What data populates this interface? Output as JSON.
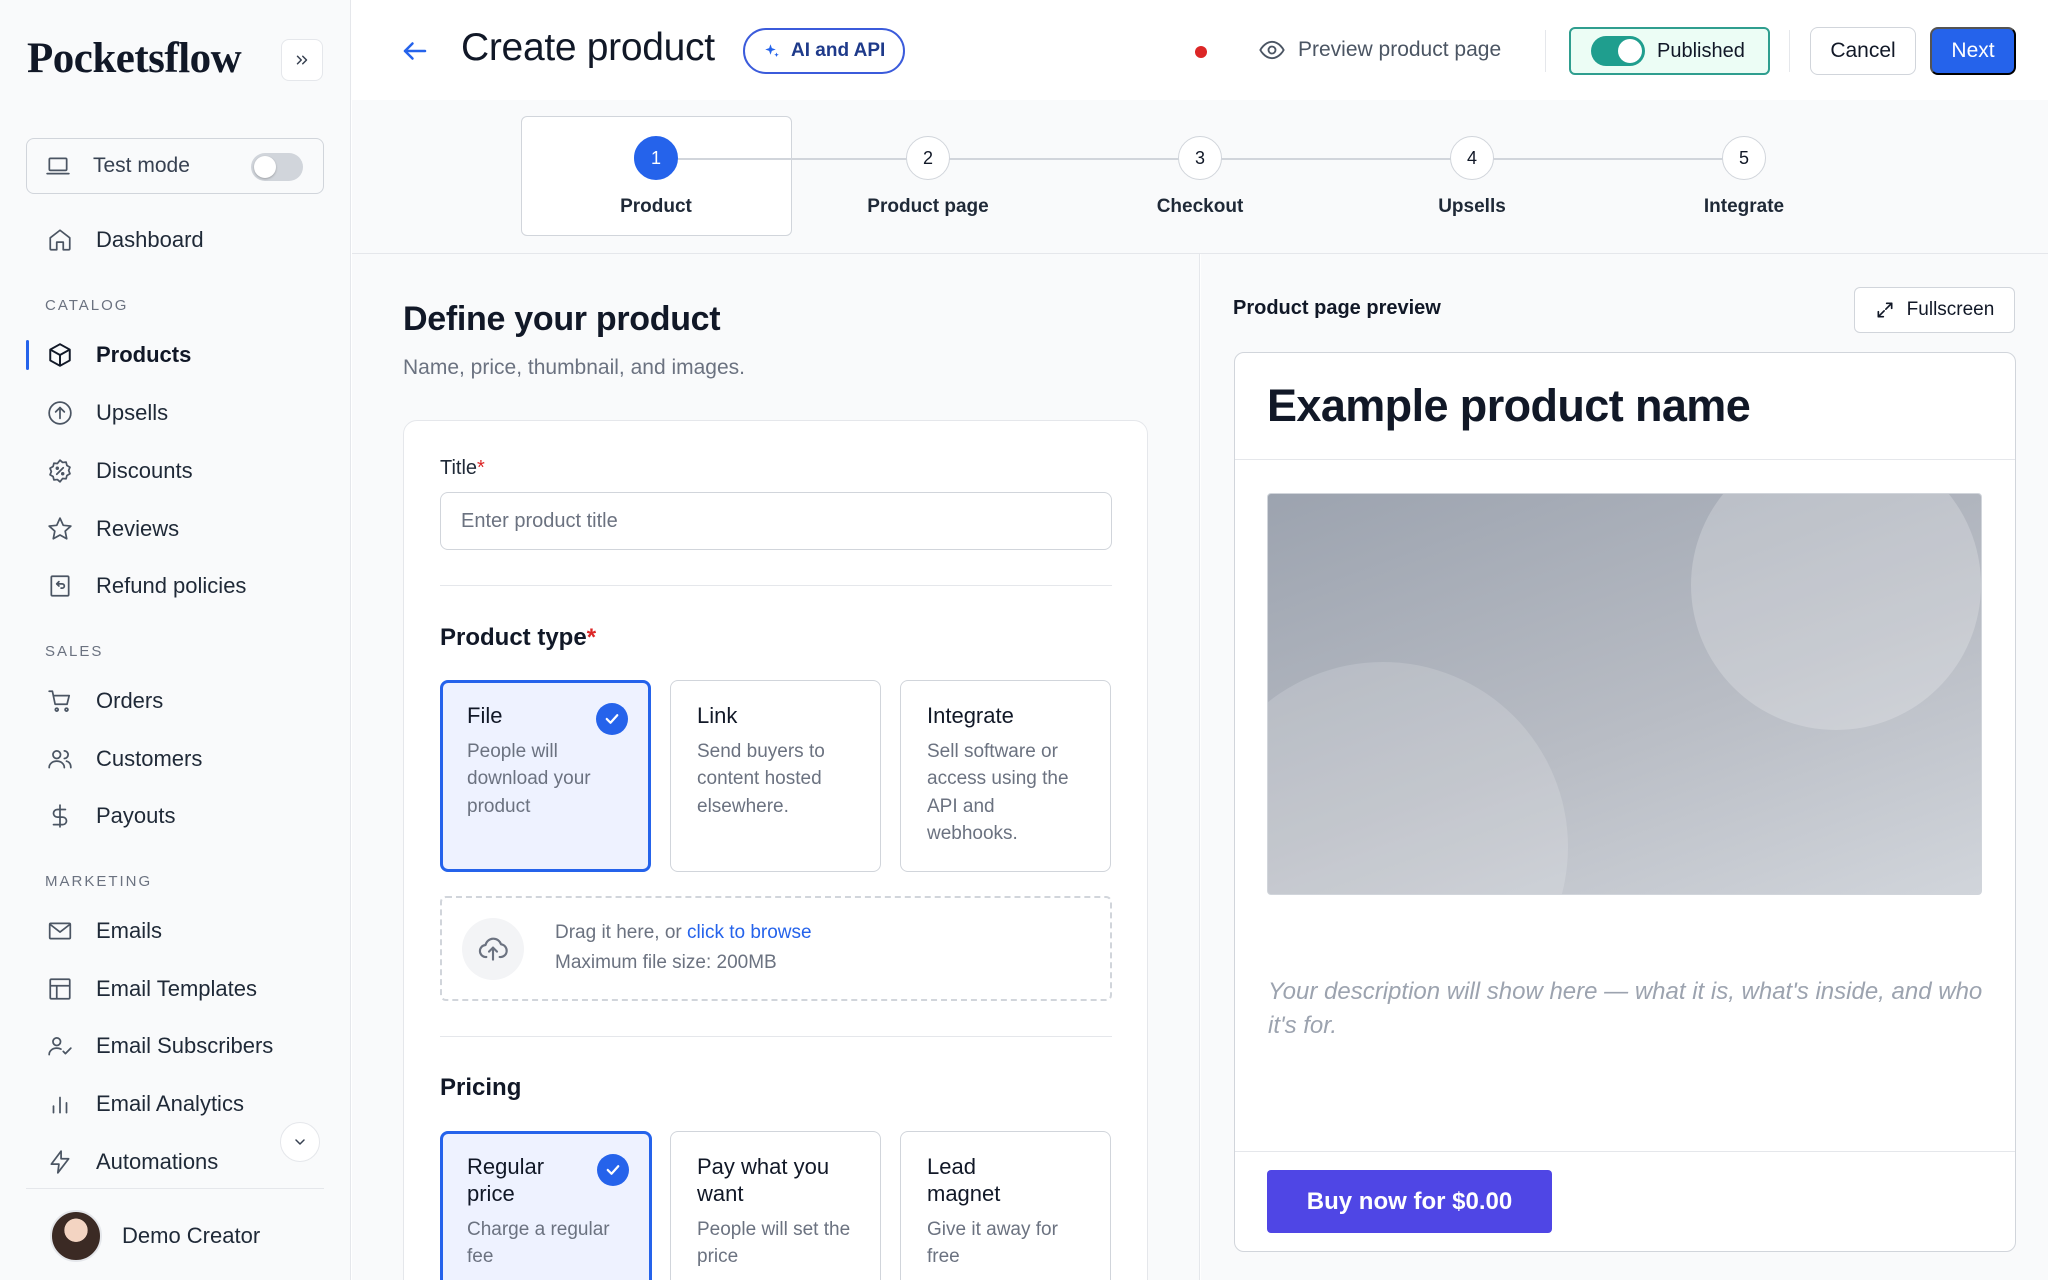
{
  "app": {
    "brand": "Pocketsflow"
  },
  "sidebar": {
    "test_mode_label": "Test mode",
    "dashboard": "Dashboard",
    "sections": {
      "catalog": "CATALOG",
      "sales": "SALES",
      "marketing": "MARKETING"
    },
    "catalog": [
      "Products",
      "Upsells",
      "Discounts",
      "Reviews",
      "Refund policies"
    ],
    "sales": [
      "Orders",
      "Customers",
      "Payouts"
    ],
    "marketing": [
      "Emails",
      "Email Templates",
      "Email Subscribers",
      "Email Analytics",
      "Automations"
    ],
    "active_item": "Products",
    "user_name": "Demo Creator"
  },
  "header": {
    "title": "Create product",
    "ai_label": "AI and API",
    "preview_label": "Preview product page",
    "published_label": "Published",
    "cancel_label": "Cancel",
    "next_label": "Next"
  },
  "stepper": {
    "steps": [
      {
        "num": "1",
        "label": "Product"
      },
      {
        "num": "2",
        "label": "Product page"
      },
      {
        "num": "3",
        "label": "Checkout"
      },
      {
        "num": "4",
        "label": "Upsells"
      },
      {
        "num": "5",
        "label": "Integrate"
      }
    ],
    "active": 1
  },
  "form": {
    "section_title": "Define your product",
    "section_subtitle": "Name, price, thumbnail, and images.",
    "title_label": "Title",
    "required_mark": "*",
    "title_value": "",
    "title_placeholder": "Enter product title",
    "product_type_label": "Product type",
    "product_types": [
      {
        "title": "File",
        "desc": "People will download your product"
      },
      {
        "title": "Link",
        "desc": "Send buyers to content hosted elsewhere."
      },
      {
        "title": "Integrate",
        "desc": "Sell software or access using the API and webhooks."
      }
    ],
    "selected_product_type": "File",
    "upload": {
      "text": "Drag it here, or ",
      "link": "click to browse",
      "limit": "Maximum file size: 200MB"
    },
    "pricing_label": "Pricing",
    "pricing_options": [
      {
        "title": "Regular price",
        "desc": "Charge a regular fee"
      },
      {
        "title": "Pay what you want",
        "desc": "People will set the price"
      },
      {
        "title": "Lead magnet",
        "desc": "Give it away for free"
      }
    ],
    "selected_pricing": "Regular price"
  },
  "preview": {
    "title": "Product page preview",
    "fullscreen_label": "Fullscreen",
    "product_name": "Example product name",
    "description": "Your description will show here — what it is, what's inside, and who it's for.",
    "buy_label": "Buy now for $0.00"
  },
  "colors": {
    "accent": "#2563eb",
    "buy_button": "#4f46e5",
    "published_toggle": "#1f9e8e",
    "required": "#dc2626"
  }
}
